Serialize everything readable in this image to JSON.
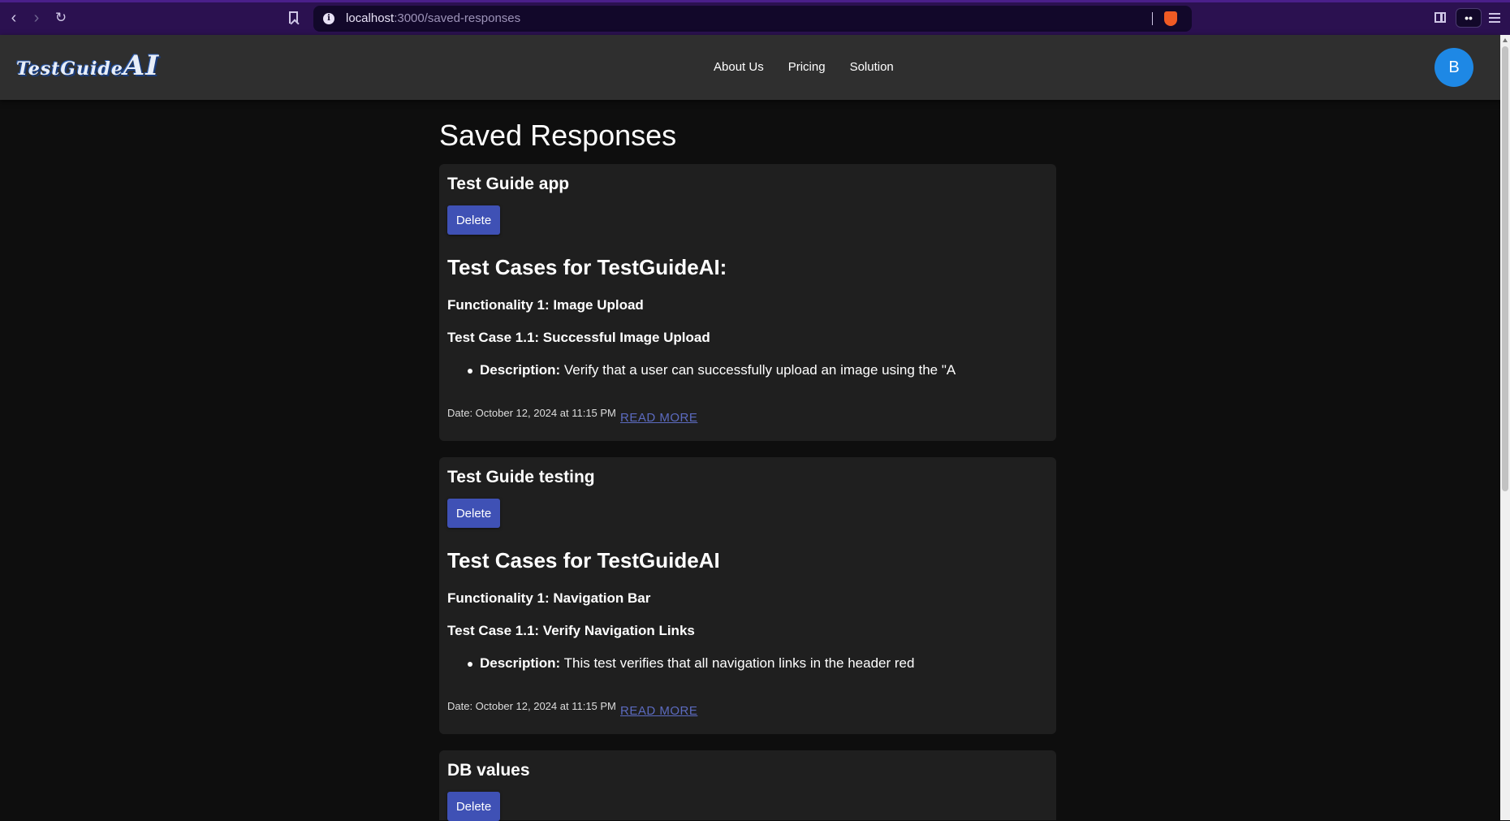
{
  "browser": {
    "url_host": "localhost",
    "url_path": ":3000/saved-responses",
    "wallet_label": "••"
  },
  "header": {
    "logo_small": "TestGuide",
    "logo_big": "AI",
    "nav": [
      "About Us",
      "Pricing",
      "Solution"
    ],
    "avatar_initial": "B"
  },
  "page": {
    "title": "Saved Responses"
  },
  "responses": [
    {
      "title": "Test Guide app",
      "delete_label": "Delete",
      "heading": "Test Cases for TestGuideAI:",
      "functionality": "Functionality 1: Image Upload",
      "test_case": "Test Case 1.1: Successful Image Upload",
      "description_label": "Description:",
      "description_text": " Verify that a user can successfully upload an image using the \"A",
      "date": "Date: October 12, 2024 at 11:15 PM",
      "read_more": "READ MORE"
    },
    {
      "title": "Test Guide testing",
      "delete_label": "Delete",
      "heading": "Test Cases for TestGuideAI",
      "functionality": "Functionality 1: Navigation Bar",
      "test_case": "Test Case 1.1: Verify Navigation Links",
      "description_label": "Description:",
      "description_text": " This test verifies that all navigation links in the header red",
      "date": "Date: October 12, 2024 at 11:15 PM",
      "read_more": "READ MORE"
    },
    {
      "title": "DB values",
      "delete_label": "Delete"
    }
  ]
}
